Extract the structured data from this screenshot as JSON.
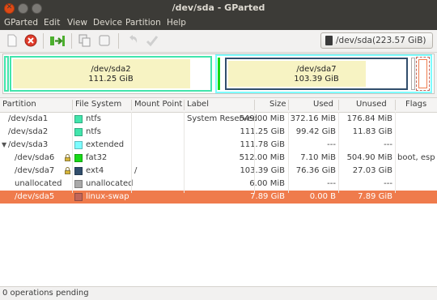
{
  "window": {
    "title": "/dev/sda - GParted"
  },
  "menu": [
    "GParted",
    "Edit",
    "View",
    "Device",
    "Partition",
    "Help"
  ],
  "toolbar": {
    "buttons": [
      "new-icon",
      "delete-icon",
      "resize-move-icon",
      "copy-icon",
      "paste-icon",
      "undo-icon",
      "apply-icon"
    ],
    "device": {
      "name": "/dev/sda",
      "size": "(223.57 GiB)"
    }
  },
  "map": {
    "sda2": {
      "name": "/dev/sda2",
      "size": "111.25 GiB"
    },
    "sda7": {
      "name": "/dev/sda7",
      "size": "103.39 GiB"
    }
  },
  "columns": [
    "Partition",
    "File System",
    "Mount Point",
    "Label",
    "Size",
    "Used",
    "Unused",
    "Flags"
  ],
  "rows": [
    {
      "partition": "/dev/sda1",
      "fs": "ntfs",
      "color": "#42e5ac",
      "mount": "",
      "label": "System Reserved",
      "size": "549.00 MiB",
      "used": "372.16 MiB",
      "unused": "176.84 MiB",
      "flags": ""
    },
    {
      "partition": "/dev/sda2",
      "fs": "ntfs",
      "color": "#42e5ac",
      "mount": "",
      "label": "",
      "size": "111.25 GiB",
      "used": "99.42 GiB",
      "unused": "11.83 GiB",
      "flags": ""
    },
    {
      "partition": "/dev/sda3",
      "fs": "extended",
      "color": "#7dfcfe",
      "mount": "",
      "label": "",
      "size": "111.78 GiB",
      "used": "---",
      "unused": "---",
      "flags": ""
    },
    {
      "partition": "/dev/sda6",
      "fs": "fat32",
      "color": "#18d918",
      "mount": "",
      "label": "",
      "size": "512.00 MiB",
      "used": "7.10 MiB",
      "unused": "504.90 MiB",
      "flags": "boot, esp"
    },
    {
      "partition": "/dev/sda7",
      "fs": "ext4",
      "color": "#314e6c",
      "mount": "/",
      "label": "",
      "size": "103.39 GiB",
      "used": "76.36 GiB",
      "unused": "27.03 GiB",
      "flags": ""
    },
    {
      "partition": "unallocated",
      "fs": "unallocated",
      "color": "#a9a9a9",
      "mount": "",
      "label": "",
      "size": "6.00 MiB",
      "used": "---",
      "unused": "---",
      "flags": ""
    },
    {
      "partition": "/dev/sda5",
      "fs": "linux-swap",
      "color": "#c1665a",
      "mount": "",
      "label": "",
      "size": "7.89 GiB",
      "used": "0.00 B",
      "unused": "7.89 GiB",
      "flags": ""
    }
  ],
  "status": "0 operations pending",
  "colors": {
    "selection": "#ef7b4c",
    "titlebar": "#3c3b37"
  }
}
